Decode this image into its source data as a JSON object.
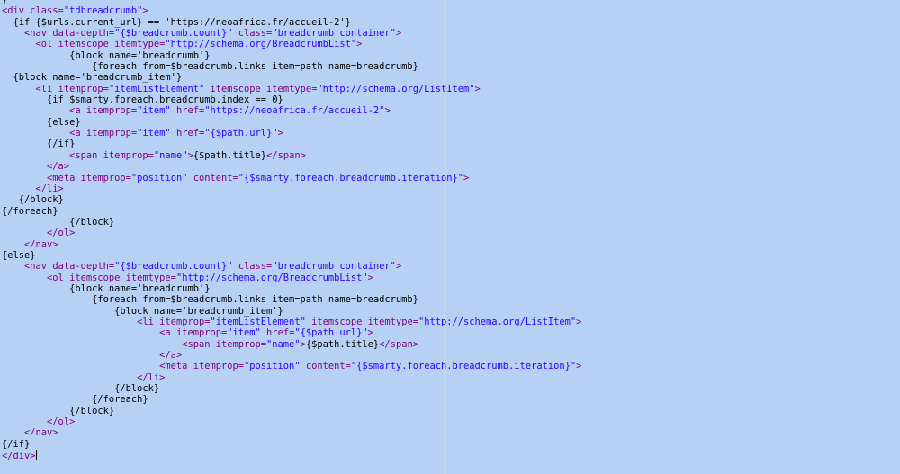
{
  "editor": {
    "lines": [
      [
        {
          "t": "}",
          "c": "txt"
        }
      ],
      [
        {
          "t": "<div ",
          "c": "tag"
        },
        {
          "t": "class=",
          "c": "attr"
        },
        {
          "t": "\"tdbreadcrumb\"",
          "c": "val"
        },
        {
          "t": ">",
          "c": "tag"
        }
      ],
      [
        {
          "t": "  {if {$urls.current_url} == 'https://neoafrica.fr/accueil-2'}",
          "c": "txt"
        }
      ],
      [
        {
          "t": "    <nav ",
          "c": "tag"
        },
        {
          "t": "data-depth=",
          "c": "attr"
        },
        {
          "t": "\"{$breadcrumb.count}\"",
          "c": "val"
        },
        {
          "t": " class=",
          "c": "attr"
        },
        {
          "t": "\"breadcrumb container\"",
          "c": "val"
        },
        {
          "t": ">",
          "c": "tag"
        }
      ],
      [
        {
          "t": "      <ol ",
          "c": "tag"
        },
        {
          "t": "itemscope itemtype=",
          "c": "attr"
        },
        {
          "t": "\"http://schema.org/BreadcrumbList\"",
          "c": "val"
        },
        {
          "t": ">",
          "c": "tag"
        }
      ],
      [
        {
          "t": "            {block name='breadcrumb'}",
          "c": "txt"
        }
      ],
      [
        {
          "t": "                {foreach from=$breadcrumb.links item=path name=breadcrumb}",
          "c": "txt"
        }
      ],
      [
        {
          "t": "  {block name='breadcrumb_item'}",
          "c": "txt"
        }
      ],
      [
        {
          "t": "      <li ",
          "c": "tag"
        },
        {
          "t": "itemprop=",
          "c": "attr"
        },
        {
          "t": "\"itemListElement\"",
          "c": "val"
        },
        {
          "t": " itemscope itemtype=",
          "c": "attr"
        },
        {
          "t": "\"http://schema.org/ListItem\"",
          "c": "val"
        },
        {
          "t": ">",
          "c": "tag"
        }
      ],
      [
        {
          "t": "        {if $smarty.foreach.breadcrumb.index == 0}",
          "c": "txt"
        }
      ],
      [
        {
          "t": "            <a ",
          "c": "tag"
        },
        {
          "t": "itemprop=",
          "c": "attr"
        },
        {
          "t": "\"item\"",
          "c": "val"
        },
        {
          "t": " href=",
          "c": "attr"
        },
        {
          "t": "\"https://neoafrica.fr/accueil-2\"",
          "c": "val"
        },
        {
          "t": ">",
          "c": "tag"
        }
      ],
      [
        {
          "t": "        {else}",
          "c": "txt"
        }
      ],
      [
        {
          "t": "            <a ",
          "c": "tag"
        },
        {
          "t": "itemprop=",
          "c": "attr"
        },
        {
          "t": "\"item\"",
          "c": "val"
        },
        {
          "t": " href=",
          "c": "attr"
        },
        {
          "t": "\"{$path.url}\"",
          "c": "val"
        },
        {
          "t": ">",
          "c": "tag"
        }
      ],
      [
        {
          "t": "        {/if}",
          "c": "txt"
        }
      ],
      [
        {
          "t": "            <span ",
          "c": "tag"
        },
        {
          "t": "itemprop=",
          "c": "attr"
        },
        {
          "t": "\"name\"",
          "c": "val"
        },
        {
          "t": ">",
          "c": "tag"
        },
        {
          "t": "{$path.title}",
          "c": "txt"
        },
        {
          "t": "</span>",
          "c": "tag"
        }
      ],
      [
        {
          "t": "        </a>",
          "c": "tag"
        }
      ],
      [
        {
          "t": "        <meta ",
          "c": "tag"
        },
        {
          "t": "itemprop=",
          "c": "attr"
        },
        {
          "t": "\"position\"",
          "c": "val"
        },
        {
          "t": " content=",
          "c": "attr"
        },
        {
          "t": "\"{$smarty.foreach.breadcrumb.iteration}\"",
          "c": "val"
        },
        {
          "t": ">",
          "c": "tag"
        }
      ],
      [
        {
          "t": "      </li>",
          "c": "tag"
        }
      ],
      [
        {
          "t": "   {/block}",
          "c": "txt"
        }
      ],
      [
        {
          "t": "{/foreach}",
          "c": "txt"
        }
      ],
      [
        {
          "t": "            {/block}",
          "c": "txt"
        }
      ],
      [
        {
          "t": "        </ol>",
          "c": "tag"
        }
      ],
      [
        {
          "t": "    </nav>",
          "c": "tag"
        }
      ],
      [
        {
          "t": "{else}",
          "c": "txt"
        }
      ],
      [
        {
          "t": "    <nav ",
          "c": "tag"
        },
        {
          "t": "data-depth=",
          "c": "attr"
        },
        {
          "t": "\"{$breadcrumb.count}\"",
          "c": "val"
        },
        {
          "t": " class=",
          "c": "attr"
        },
        {
          "t": "\"breadcrumb container\"",
          "c": "val"
        },
        {
          "t": ">",
          "c": "tag"
        }
      ],
      [
        {
          "t": "        <ol ",
          "c": "tag"
        },
        {
          "t": "itemscope itemtype=",
          "c": "attr"
        },
        {
          "t": "\"http://schema.org/BreadcrumbList\"",
          "c": "val"
        },
        {
          "t": ">",
          "c": "tag"
        }
      ],
      [
        {
          "t": "            {block name='breadcrumb'}",
          "c": "txt"
        }
      ],
      [
        {
          "t": "                {foreach from=$breadcrumb.links item=path name=breadcrumb}",
          "c": "txt"
        }
      ],
      [
        {
          "t": "                    {block name='breadcrumb_item'}",
          "c": "txt"
        }
      ],
      [
        {
          "t": "                        <li ",
          "c": "tag"
        },
        {
          "t": "itemprop=",
          "c": "attr"
        },
        {
          "t": "\"itemListElement\"",
          "c": "val"
        },
        {
          "t": " itemscope itemtype=",
          "c": "attr"
        },
        {
          "t": "\"http://schema.org/ListItem\"",
          "c": "val"
        },
        {
          "t": ">",
          "c": "tag"
        }
      ],
      [
        {
          "t": "                            <a ",
          "c": "tag"
        },
        {
          "t": "itemprop=",
          "c": "attr"
        },
        {
          "t": "\"item\"",
          "c": "val"
        },
        {
          "t": " href=",
          "c": "attr"
        },
        {
          "t": "\"{$path.url}\"",
          "c": "val"
        },
        {
          "t": ">",
          "c": "tag"
        }
      ],
      [
        {
          "t": "                                <span ",
          "c": "tag"
        },
        {
          "t": "itemprop=",
          "c": "attr"
        },
        {
          "t": "\"name\"",
          "c": "val"
        },
        {
          "t": ">",
          "c": "tag"
        },
        {
          "t": "{$path.title}",
          "c": "txt"
        },
        {
          "t": "</span>",
          "c": "tag"
        }
      ],
      [
        {
          "t": "                            </a>",
          "c": "tag"
        }
      ],
      [
        {
          "t": "                            <meta ",
          "c": "tag"
        },
        {
          "t": "itemprop=",
          "c": "attr"
        },
        {
          "t": "\"position\"",
          "c": "val"
        },
        {
          "t": " content=",
          "c": "attr"
        },
        {
          "t": "\"{$smarty.foreach.breadcrumb.iteration}\"",
          "c": "val"
        },
        {
          "t": ">",
          "c": "tag"
        }
      ],
      [
        {
          "t": "                        </li>",
          "c": "tag"
        }
      ],
      [
        {
          "t": "                    {/block}",
          "c": "txt"
        }
      ],
      [
        {
          "t": "                {/foreach}",
          "c": "txt"
        }
      ],
      [
        {
          "t": "            {/block}",
          "c": "txt"
        }
      ],
      [
        {
          "t": "        </ol>",
          "c": "tag"
        }
      ],
      [
        {
          "t": "    </nav>",
          "c": "tag"
        }
      ],
      [
        {
          "t": "{/if}",
          "c": "txt"
        }
      ],
      [
        {
          "t": "</div>",
          "c": "tag"
        }
      ]
    ],
    "colors": {
      "selection": "#b7d1f4",
      "tag": "#7f007f",
      "value": "#2a00ff",
      "text": "#000000"
    }
  }
}
